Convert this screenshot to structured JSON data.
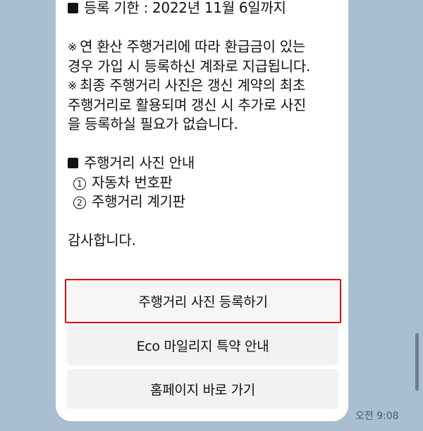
{
  "message": {
    "deadline": "등록 기한 : 2022년 11월 6일까지",
    "note1_mark": "※",
    "note1_line1": "연 환산 주행거리에 따라 환급금이 있는",
    "note1_line2": "경우 가입 시 등록하신 계좌로 지급됩니다.",
    "note2_mark": "※",
    "note2_line1": "최종 주행거리 사진은 갱신 계약의 최초",
    "note2_line2": "주행거리로 활용되며 갱신 시 추가로 사진",
    "note2_line3": "을 등록하실 필요가 없습니다.",
    "photo_guide_title": "주행거리 사진 안내",
    "photo_items": [
      {
        "num": "1",
        "label": "자동차 번호판"
      },
      {
        "num": "2",
        "label": "주행거리 계기판"
      }
    ],
    "closing": "감사합니다."
  },
  "buttons": {
    "register_photo": "주행거리 사진 등록하기",
    "eco_mileage": "Eco 마일리지 특약 안내",
    "homepage": "홈페이지 바로 가기"
  },
  "timestamp": "오전 9:08",
  "colors": {
    "background": "#a9bfd1",
    "bubble": "#ffffff",
    "button": "#f2f2f2",
    "highlight_border": "#e00d0d"
  },
  "icons": {
    "bullet": "black-square-icon",
    "note": "reference-mark-icon",
    "number": "circled-number-icon"
  }
}
